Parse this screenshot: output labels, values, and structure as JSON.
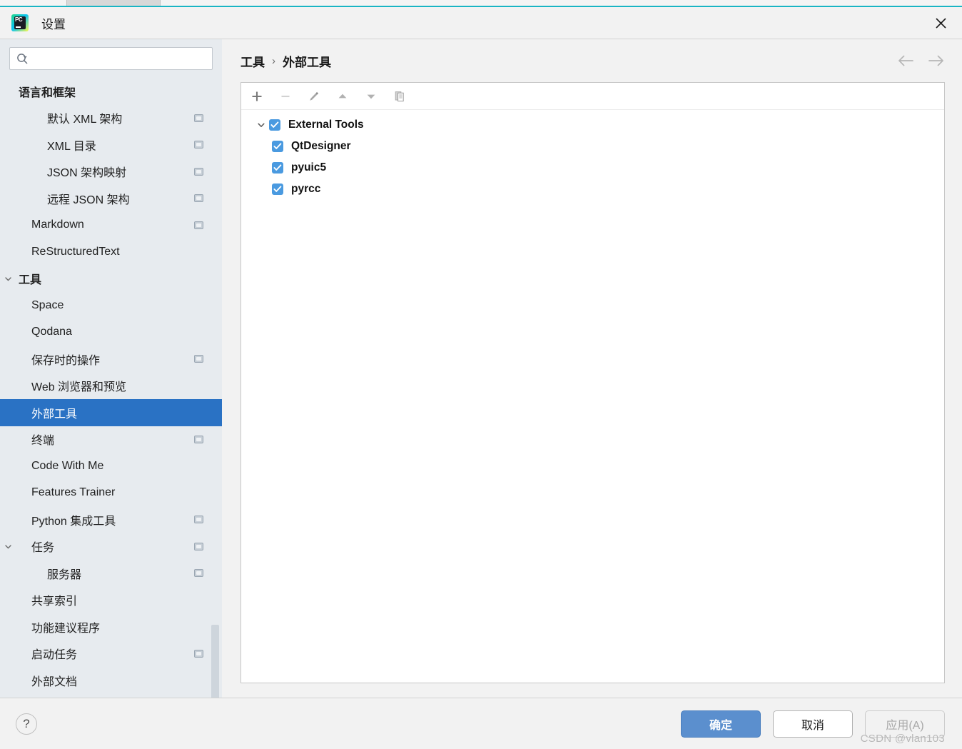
{
  "window": {
    "title": "设置",
    "app_icon": "pycharm-logo-icon",
    "close_icon": "close-icon",
    "accent_color": "#19b5c4"
  },
  "search": {
    "value": "",
    "placeholder": "",
    "icon": "search-icon"
  },
  "sidebar": {
    "scroll_indicator": true,
    "items": [
      {
        "label": "语言和框架",
        "level": 0,
        "group": true,
        "twisty": "",
        "badge": false,
        "selected": false
      },
      {
        "label": "默认 XML 架构",
        "level": 2,
        "group": false,
        "twisty": "",
        "badge": true,
        "selected": false
      },
      {
        "label": "XML 目录",
        "level": 2,
        "group": false,
        "twisty": "",
        "badge": true,
        "selected": false
      },
      {
        "label": "JSON 架构映射",
        "level": 2,
        "group": false,
        "twisty": "",
        "badge": true,
        "selected": false
      },
      {
        "label": "远程 JSON 架构",
        "level": 2,
        "group": false,
        "twisty": "",
        "badge": true,
        "selected": false
      },
      {
        "label": "Markdown",
        "level": 1,
        "group": false,
        "twisty": "",
        "badge": true,
        "selected": false
      },
      {
        "label": "ReStructuredText",
        "level": 1,
        "group": false,
        "twisty": "",
        "badge": false,
        "selected": false
      },
      {
        "label": "工具",
        "level": 0,
        "group": true,
        "twisty": "chevron-down-icon",
        "badge": false,
        "selected": false
      },
      {
        "label": "Space",
        "level": 1,
        "group": false,
        "twisty": "",
        "badge": false,
        "selected": false
      },
      {
        "label": "Qodana",
        "level": 1,
        "group": false,
        "twisty": "",
        "badge": false,
        "selected": false
      },
      {
        "label": "保存时的操作",
        "level": 1,
        "group": false,
        "twisty": "",
        "badge": true,
        "selected": false
      },
      {
        "label": "Web 浏览器和预览",
        "level": 1,
        "group": false,
        "twisty": "",
        "badge": false,
        "selected": false
      },
      {
        "label": "外部工具",
        "level": 1,
        "group": false,
        "twisty": "",
        "badge": false,
        "selected": true
      },
      {
        "label": "终端",
        "level": 1,
        "group": false,
        "twisty": "",
        "badge": true,
        "selected": false
      },
      {
        "label": "Code With Me",
        "level": 1,
        "group": false,
        "twisty": "",
        "badge": false,
        "selected": false
      },
      {
        "label": "Features Trainer",
        "level": 1,
        "group": false,
        "twisty": "",
        "badge": false,
        "selected": false
      },
      {
        "label": "Python 集成工具",
        "level": 1,
        "group": false,
        "twisty": "",
        "badge": true,
        "selected": false
      },
      {
        "label": "任务",
        "level": 1,
        "group": false,
        "twisty": "chevron-down-icon",
        "badge": true,
        "selected": false
      },
      {
        "label": "服务器",
        "level": 2,
        "group": false,
        "twisty": "",
        "badge": true,
        "selected": false
      },
      {
        "label": "共享索引",
        "level": 1,
        "group": false,
        "twisty": "",
        "badge": false,
        "selected": false
      },
      {
        "label": "功能建议程序",
        "level": 1,
        "group": false,
        "twisty": "",
        "badge": false,
        "selected": false
      },
      {
        "label": "启动任务",
        "level": 1,
        "group": false,
        "twisty": "",
        "badge": true,
        "selected": false
      },
      {
        "label": "外部文档",
        "level": 1,
        "group": false,
        "twisty": "",
        "badge": false,
        "selected": false
      }
    ]
  },
  "content": {
    "breadcrumb": {
      "parent": "工具",
      "separator": "›",
      "current": "外部工具"
    },
    "nav": {
      "back_icon": "arrow-left-icon",
      "forward_icon": "arrow-right-icon"
    },
    "toolbar": [
      {
        "name": "add-button",
        "icon": "plus-icon",
        "enabled": true
      },
      {
        "name": "remove-button",
        "icon": "minus-icon",
        "enabled": false
      },
      {
        "name": "edit-button",
        "icon": "pencil-icon",
        "enabled": true
      },
      {
        "name": "move-up-button",
        "icon": "triangle-up-icon",
        "enabled": true
      },
      {
        "name": "move-down-button",
        "icon": "triangle-down-icon",
        "enabled": true
      },
      {
        "name": "copy-button",
        "icon": "copy-icon",
        "enabled": true
      }
    ],
    "tools_tree": [
      {
        "label": "External Tools",
        "child": false,
        "checked": true,
        "twisty": "chevron-down-icon"
      },
      {
        "label": "QtDesigner",
        "child": true,
        "checked": true,
        "twisty": ""
      },
      {
        "label": "pyuic5",
        "child": true,
        "checked": true,
        "twisty": ""
      },
      {
        "label": "pyrcc",
        "child": true,
        "checked": true,
        "twisty": ""
      }
    ],
    "checkbox_color": "#4a9ae0"
  },
  "footer": {
    "help_label": "?",
    "ok_label": "确定",
    "cancel_label": "取消",
    "apply_label": "应用(A)",
    "apply_enabled": false,
    "ok_color": "#5b8fce",
    "watermark": "CSDN @vlan103"
  }
}
